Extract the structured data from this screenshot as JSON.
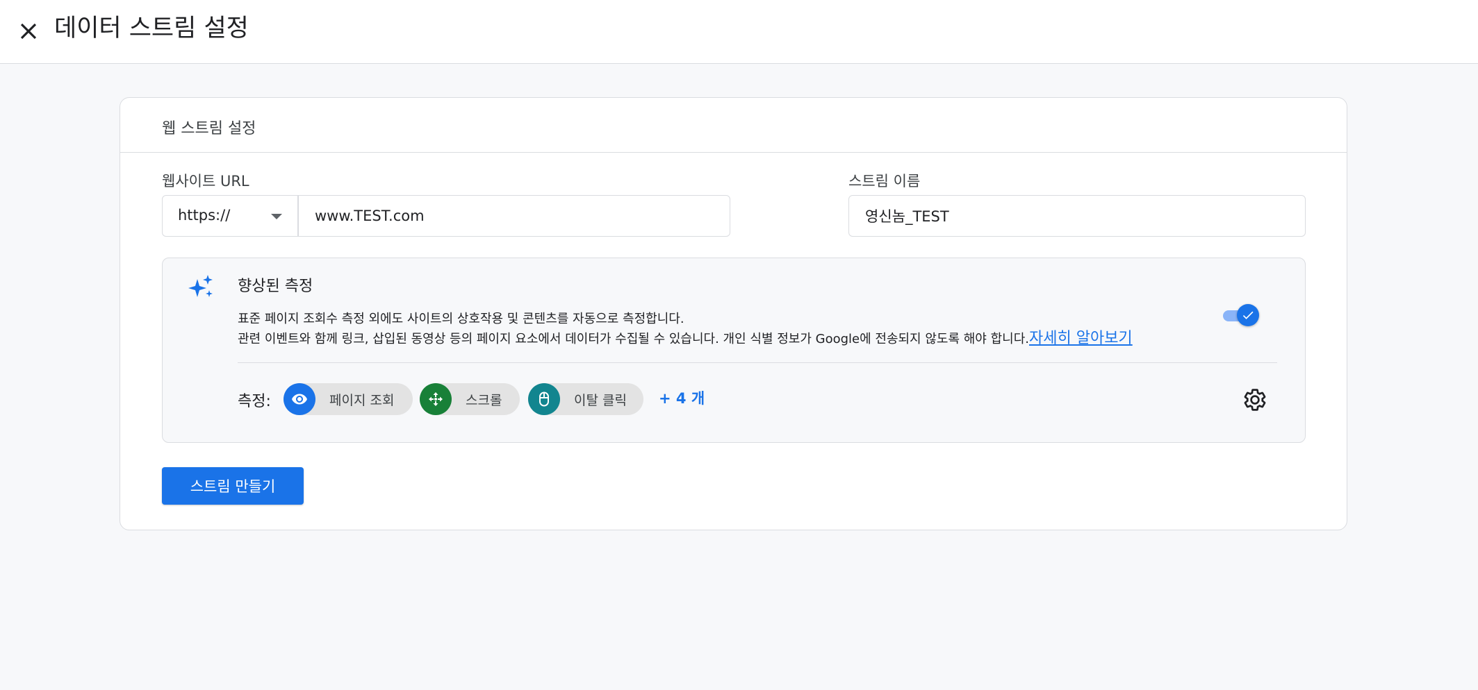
{
  "header": {
    "title": "데이터 스트림 설정",
    "close_icon": "close-icon"
  },
  "card": {
    "title": "웹 스트림 설정",
    "website_url": {
      "label": "웹사이트 URL",
      "protocol": "https://",
      "value": "www.TEST.com"
    },
    "stream_name": {
      "label": "스트림 이름",
      "value": "영신놈_TEST"
    },
    "enhanced_measurement": {
      "icon": "sparkle-icon",
      "title": "향상된 측정",
      "description_line1": "표준 페이지 조회수 측정 외에도 사이트의 상호작용 및 콘텐츠를 자동으로 측정합니다.",
      "description_line2": "관련 이벤트와 함께 링크, 삽입된 동영상 등의 페이지 요소에서 데이터가 수집될 수 있습니다. 개인 식별 정보가 Google에 전송되지 않도록 해야 합니다.",
      "learn_more": "자세히 알아보기",
      "enabled": true,
      "measure_label": "측정:",
      "chips": [
        {
          "label": "페이지 조회",
          "icon": "eye-icon",
          "color": "#1a73e8"
        },
        {
          "label": "스크롤",
          "icon": "move-arrows-icon",
          "color": "#188038"
        },
        {
          "label": "이탈 클릭",
          "icon": "mouse-icon",
          "color": "#12858f"
        }
      ],
      "more": "+ 4 개",
      "settings_icon": "gear-icon"
    },
    "create_button": "스트림 만들기"
  },
  "colors": {
    "accent": "#1a73e8",
    "background": "#f7f8fa"
  }
}
